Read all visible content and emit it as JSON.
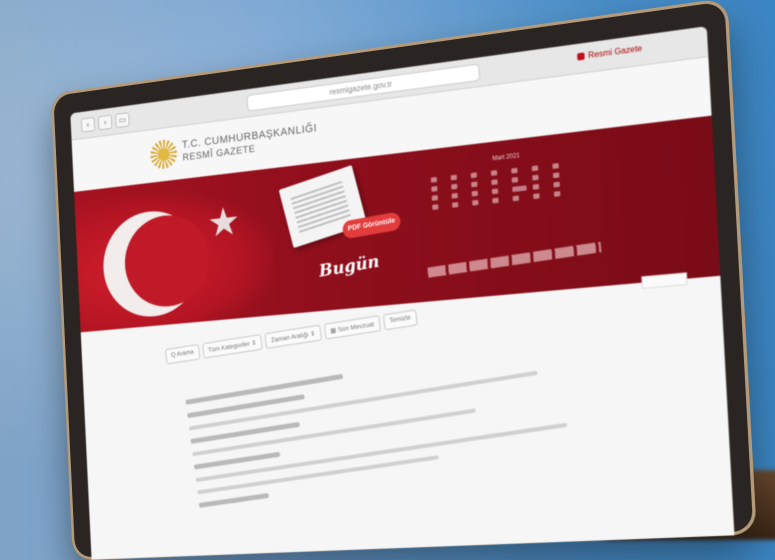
{
  "browser": {
    "url": "resmigazete.gov.tr",
    "tab_label": "Resmi Gazete"
  },
  "site": {
    "logo_line1": "T.C. CUMHURBAŞKANLIĞI",
    "logo_line2": "RESMÎ GAZETE"
  },
  "banner": {
    "pdf_button": "PDF Görüntüle",
    "today_label": "Bugün",
    "calendar_title": "Mart 2021"
  },
  "filters": [
    {
      "label": "Q  Arama"
    },
    {
      "label": "Tüm Kategoriler  ⇕"
    },
    {
      "label": "Zaman Aralığı  ⇕"
    },
    {
      "label": "▦  Son Mevzuat"
    },
    {
      "label": "Temizle"
    }
  ],
  "colors": {
    "banner_red": "#a71221",
    "accent_red": "#e23c3c",
    "background_blue": "#4d90c9"
  }
}
